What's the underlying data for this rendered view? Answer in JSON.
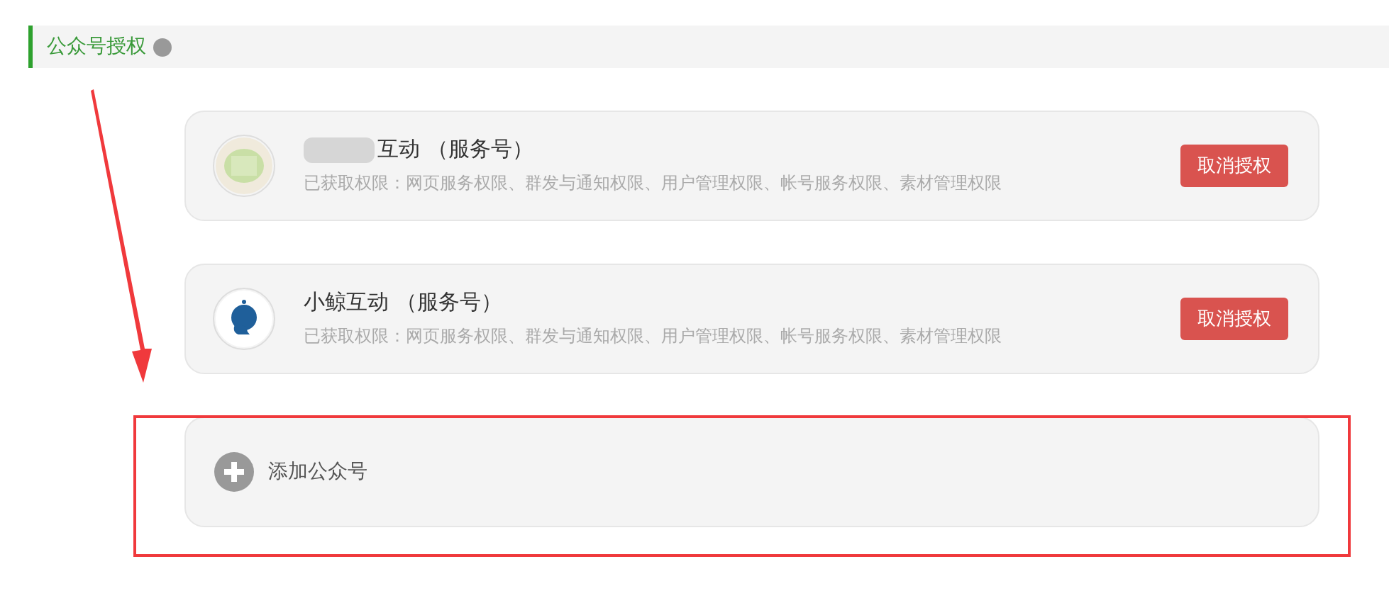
{
  "section": {
    "title": "公众号授权"
  },
  "accounts": [
    {
      "name": "互动 （服务号）",
      "redacted": true,
      "kind": "blurred",
      "permissions": "已获取权限：网页服务权限、群发与通知权限、用户管理权限、帐号服务权限、素材管理权限",
      "button": "取消授权"
    },
    {
      "name": "小鲸互动 （服务号）",
      "redacted": false,
      "kind": "whale",
      "permissions": "已获取权限：网页服务权限、群发与通知权限、用户管理权限、帐号服务权限、素材管理权限",
      "button": "取消授权"
    }
  ],
  "add": {
    "label": "添加公众号"
  }
}
